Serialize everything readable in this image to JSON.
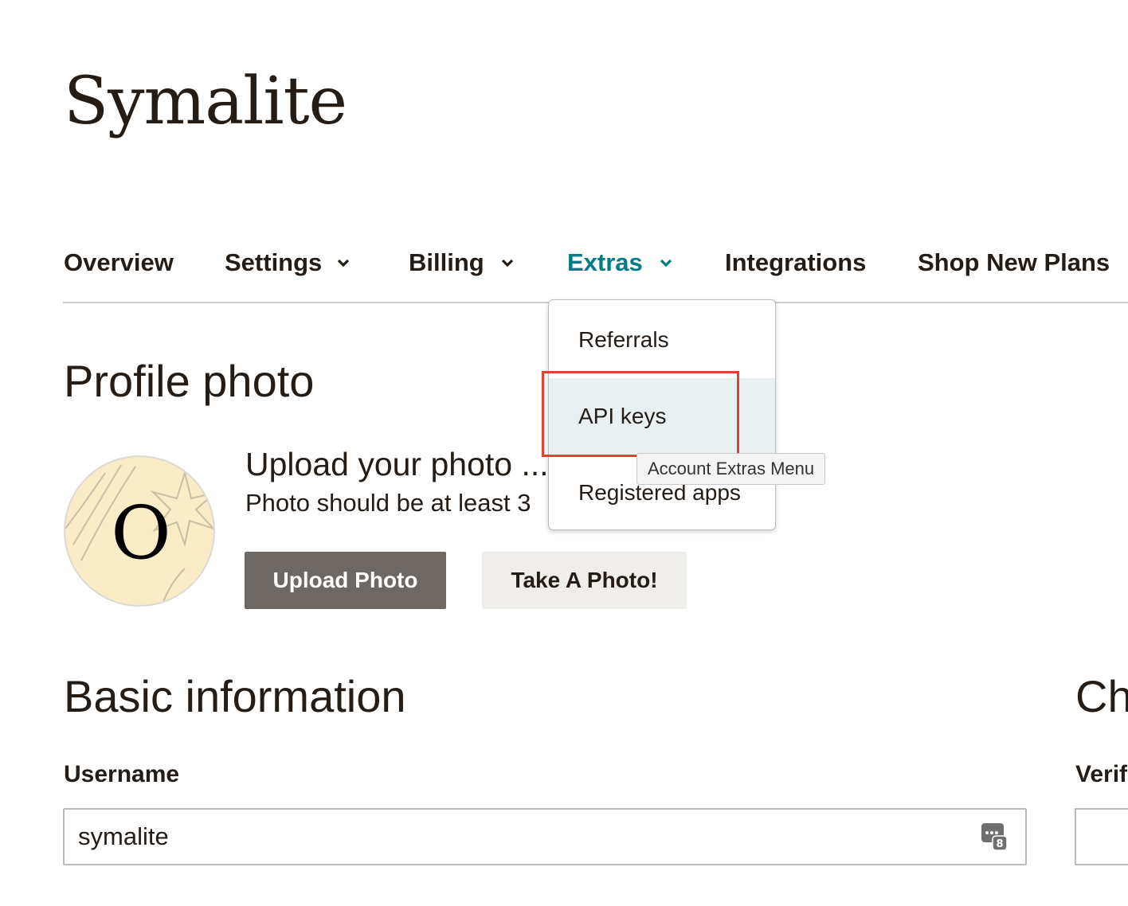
{
  "brand": {
    "name": "Symalite"
  },
  "nav": {
    "items": [
      {
        "label": "Overview",
        "dropdown": false
      },
      {
        "label": "Settings",
        "dropdown": true
      },
      {
        "label": "Billing",
        "dropdown": true
      },
      {
        "label": "Extras",
        "dropdown": true,
        "active": true
      },
      {
        "label": "Integrations",
        "dropdown": false
      },
      {
        "label": "Shop New Plans",
        "dropdown": false
      }
    ],
    "active_color": "#007c89"
  },
  "extras_menu": {
    "items": [
      "Referrals",
      "API keys",
      "Registered apps"
    ],
    "hovered": "API keys",
    "tooltip": "Account Extras Menu",
    "highlight_color": "#e3412f"
  },
  "profile": {
    "heading": "Profile photo",
    "avatar_letter": "O",
    "upload_title": "Upload your photo ...",
    "upload_hint": "Photo should be at least 3",
    "upload_button": "Upload Photo",
    "take_photo_button": "Take A Photo!"
  },
  "basic": {
    "heading": "Basic information",
    "username_label": "Username",
    "username_value": "symalite",
    "password_manager_icon": "password-manager-icon"
  },
  "right_column": {
    "heading_partial": "Ch",
    "label_partial": "Verif"
  }
}
